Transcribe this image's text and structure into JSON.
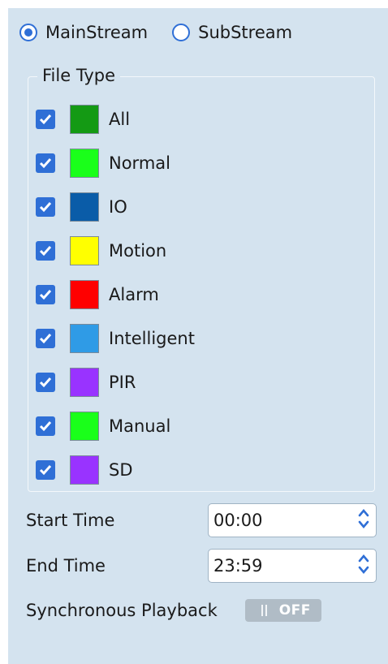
{
  "stream": {
    "options": [
      {
        "label": "MainStream",
        "selected": true
      },
      {
        "label": "SubStream",
        "selected": false
      }
    ]
  },
  "file_type": {
    "legend": "File Type",
    "items": [
      {
        "label": "All",
        "checked": true,
        "color": "#149a14"
      },
      {
        "label": "Normal",
        "checked": true,
        "color": "#1aff1a"
      },
      {
        "label": "IO",
        "checked": true,
        "color": "#0a5ca8"
      },
      {
        "label": "Motion",
        "checked": true,
        "color": "#ffff00"
      },
      {
        "label": "Alarm",
        "checked": true,
        "color": "#ff0000"
      },
      {
        "label": "Intelligent",
        "checked": true,
        "color": "#2f9be6"
      },
      {
        "label": "PIR",
        "checked": true,
        "color": "#9933ff"
      },
      {
        "label": "Manual",
        "checked": true,
        "color": "#1aff1a"
      },
      {
        "label": "SD",
        "checked": true,
        "color": "#9933ff"
      }
    ]
  },
  "start_time": {
    "label": "Start Time",
    "value": "00:00"
  },
  "end_time": {
    "label": "End Time",
    "value": "23:59"
  },
  "sync_playback": {
    "label": "Synchronous Playback",
    "state": "OFF",
    "enabled": false
  },
  "colors": {
    "accent": "#2f6fd6",
    "panel_bg": "#d4e3ef",
    "toggle_off": "#b0bcc6"
  }
}
